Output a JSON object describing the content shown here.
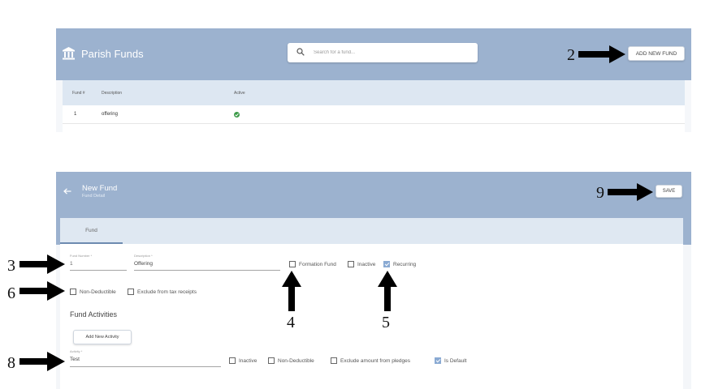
{
  "parish_funds": {
    "title": "Parish Funds",
    "search": {
      "placeholder": "Search for a fund..."
    },
    "add_button": "ADD NEW FUND",
    "table": {
      "headers": [
        "Fund #",
        "Description",
        "Active"
      ],
      "rows": [
        {
          "fund_number": "1",
          "description": "offering",
          "active": true
        }
      ]
    },
    "colors": {
      "header": "#9cb2cf",
      "active_check": "#3c9a48"
    }
  },
  "new_fund": {
    "title": "New Fund",
    "subtitle": "Fund Detail",
    "save_button": "SAVE",
    "tabs": [
      {
        "label": "Fund"
      }
    ],
    "fields": {
      "fund_number": {
        "label": "Fund Number *",
        "value": "1"
      },
      "description": {
        "label": "Description *",
        "value": "Offering"
      }
    },
    "checkboxes": {
      "formation_fund": {
        "label": "Formation Fund",
        "checked": false
      },
      "inactive": {
        "label": "Inactive",
        "checked": false
      },
      "recurring": {
        "label": "Recurring",
        "checked": true
      },
      "non_deductible": {
        "label": "Non-Deductible",
        "checked": false
      },
      "exclude_tax": {
        "label": "Exclude from tax receipts",
        "checked": false
      }
    },
    "activities": {
      "section_title": "Fund Activities",
      "add_button": "Add New Activity",
      "activity": {
        "label": "Activity *",
        "value": "Test",
        "checkboxes": {
          "inactive": {
            "label": "Inactive",
            "checked": false
          },
          "non_deductible": {
            "label": "Non-Deductible",
            "checked": false
          },
          "exclude_pledges": {
            "label": "Exclude amount from pledges",
            "checked": false
          },
          "is_default": {
            "label": "Is Default",
            "checked": true
          }
        }
      }
    },
    "colors": {
      "header": "#9cb2cf",
      "tab_bar": "#dfe8f2",
      "checked": "#8aaad3"
    }
  },
  "annotations": {
    "a2": "2",
    "a3": "3",
    "a4": "4",
    "a5": "5",
    "a6": "6",
    "a8": "8",
    "a9": "9"
  }
}
